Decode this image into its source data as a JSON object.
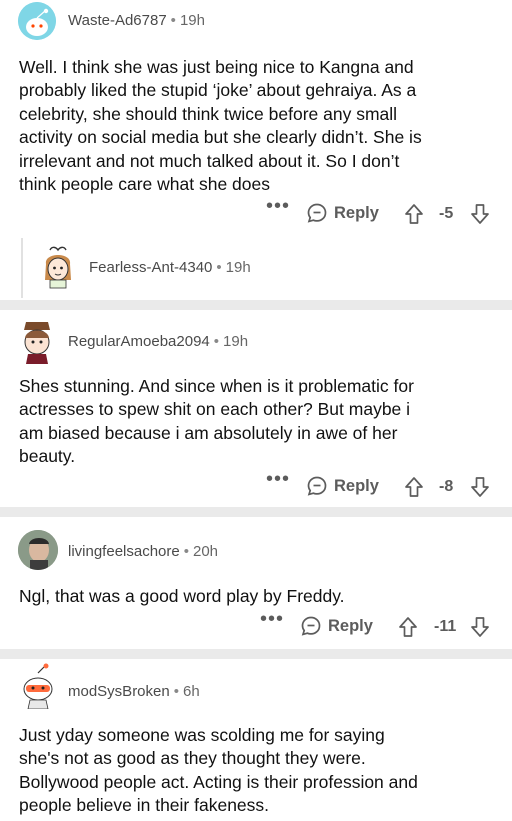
{
  "comments": [
    {
      "username": "Waste-Ad6787",
      "time": "19h",
      "lines": [
        "Well. I think she was just being nice to Kangna and",
        "probably liked the stupid ‘joke’ about gehraiya. As a",
        "celebrity, she should think twice before any small",
        "activity on social media but she clearly didn’t. She is",
        "irrelevant and not much talked about it. So I don’t",
        "think people care what she does"
      ],
      "reply_label": "Reply",
      "score": "-5",
      "more": "•••",
      "avatar_color": "#7fd6e6"
    },
    {
      "username": "Fearless-Ant-4340",
      "time": "19h",
      "collapsed": true
    },
    {
      "username": "RegularAmoeba2094",
      "time": "19h",
      "lines": [
        "Shes stunning. And since when is it problematic for",
        "actresses to spew shit on each other? But maybe i",
        "am biased because i am absolutely in awe of her",
        "beauty."
      ],
      "reply_label": "Reply",
      "score": "-8",
      "more": "•••"
    },
    {
      "username": "livingfeelsachore",
      "time": "20h",
      "lines": [
        "Ngl, that was a good word play by Freddy."
      ],
      "reply_label": "Reply",
      "score": "-11",
      "more": "•••"
    },
    {
      "username": "modSysBroken",
      "time": "6h",
      "lines": [
        "Just yday someone was scolding me for saying",
        "she's not as good as they thought they were.",
        "Bollywood people act. Acting is their profession and",
        "people believe in their fakeness."
      ]
    }
  ],
  "colors": {
    "separator": "#eaeaea",
    "action_gray": "#5c5c5c",
    "meta_gray": "#4a4a4a"
  },
  "icons": [
    "snoo-avatar",
    "reply-bubble-icon",
    "upvote-arrow-icon",
    "downvote-arrow-icon",
    "more-options-icon"
  ]
}
